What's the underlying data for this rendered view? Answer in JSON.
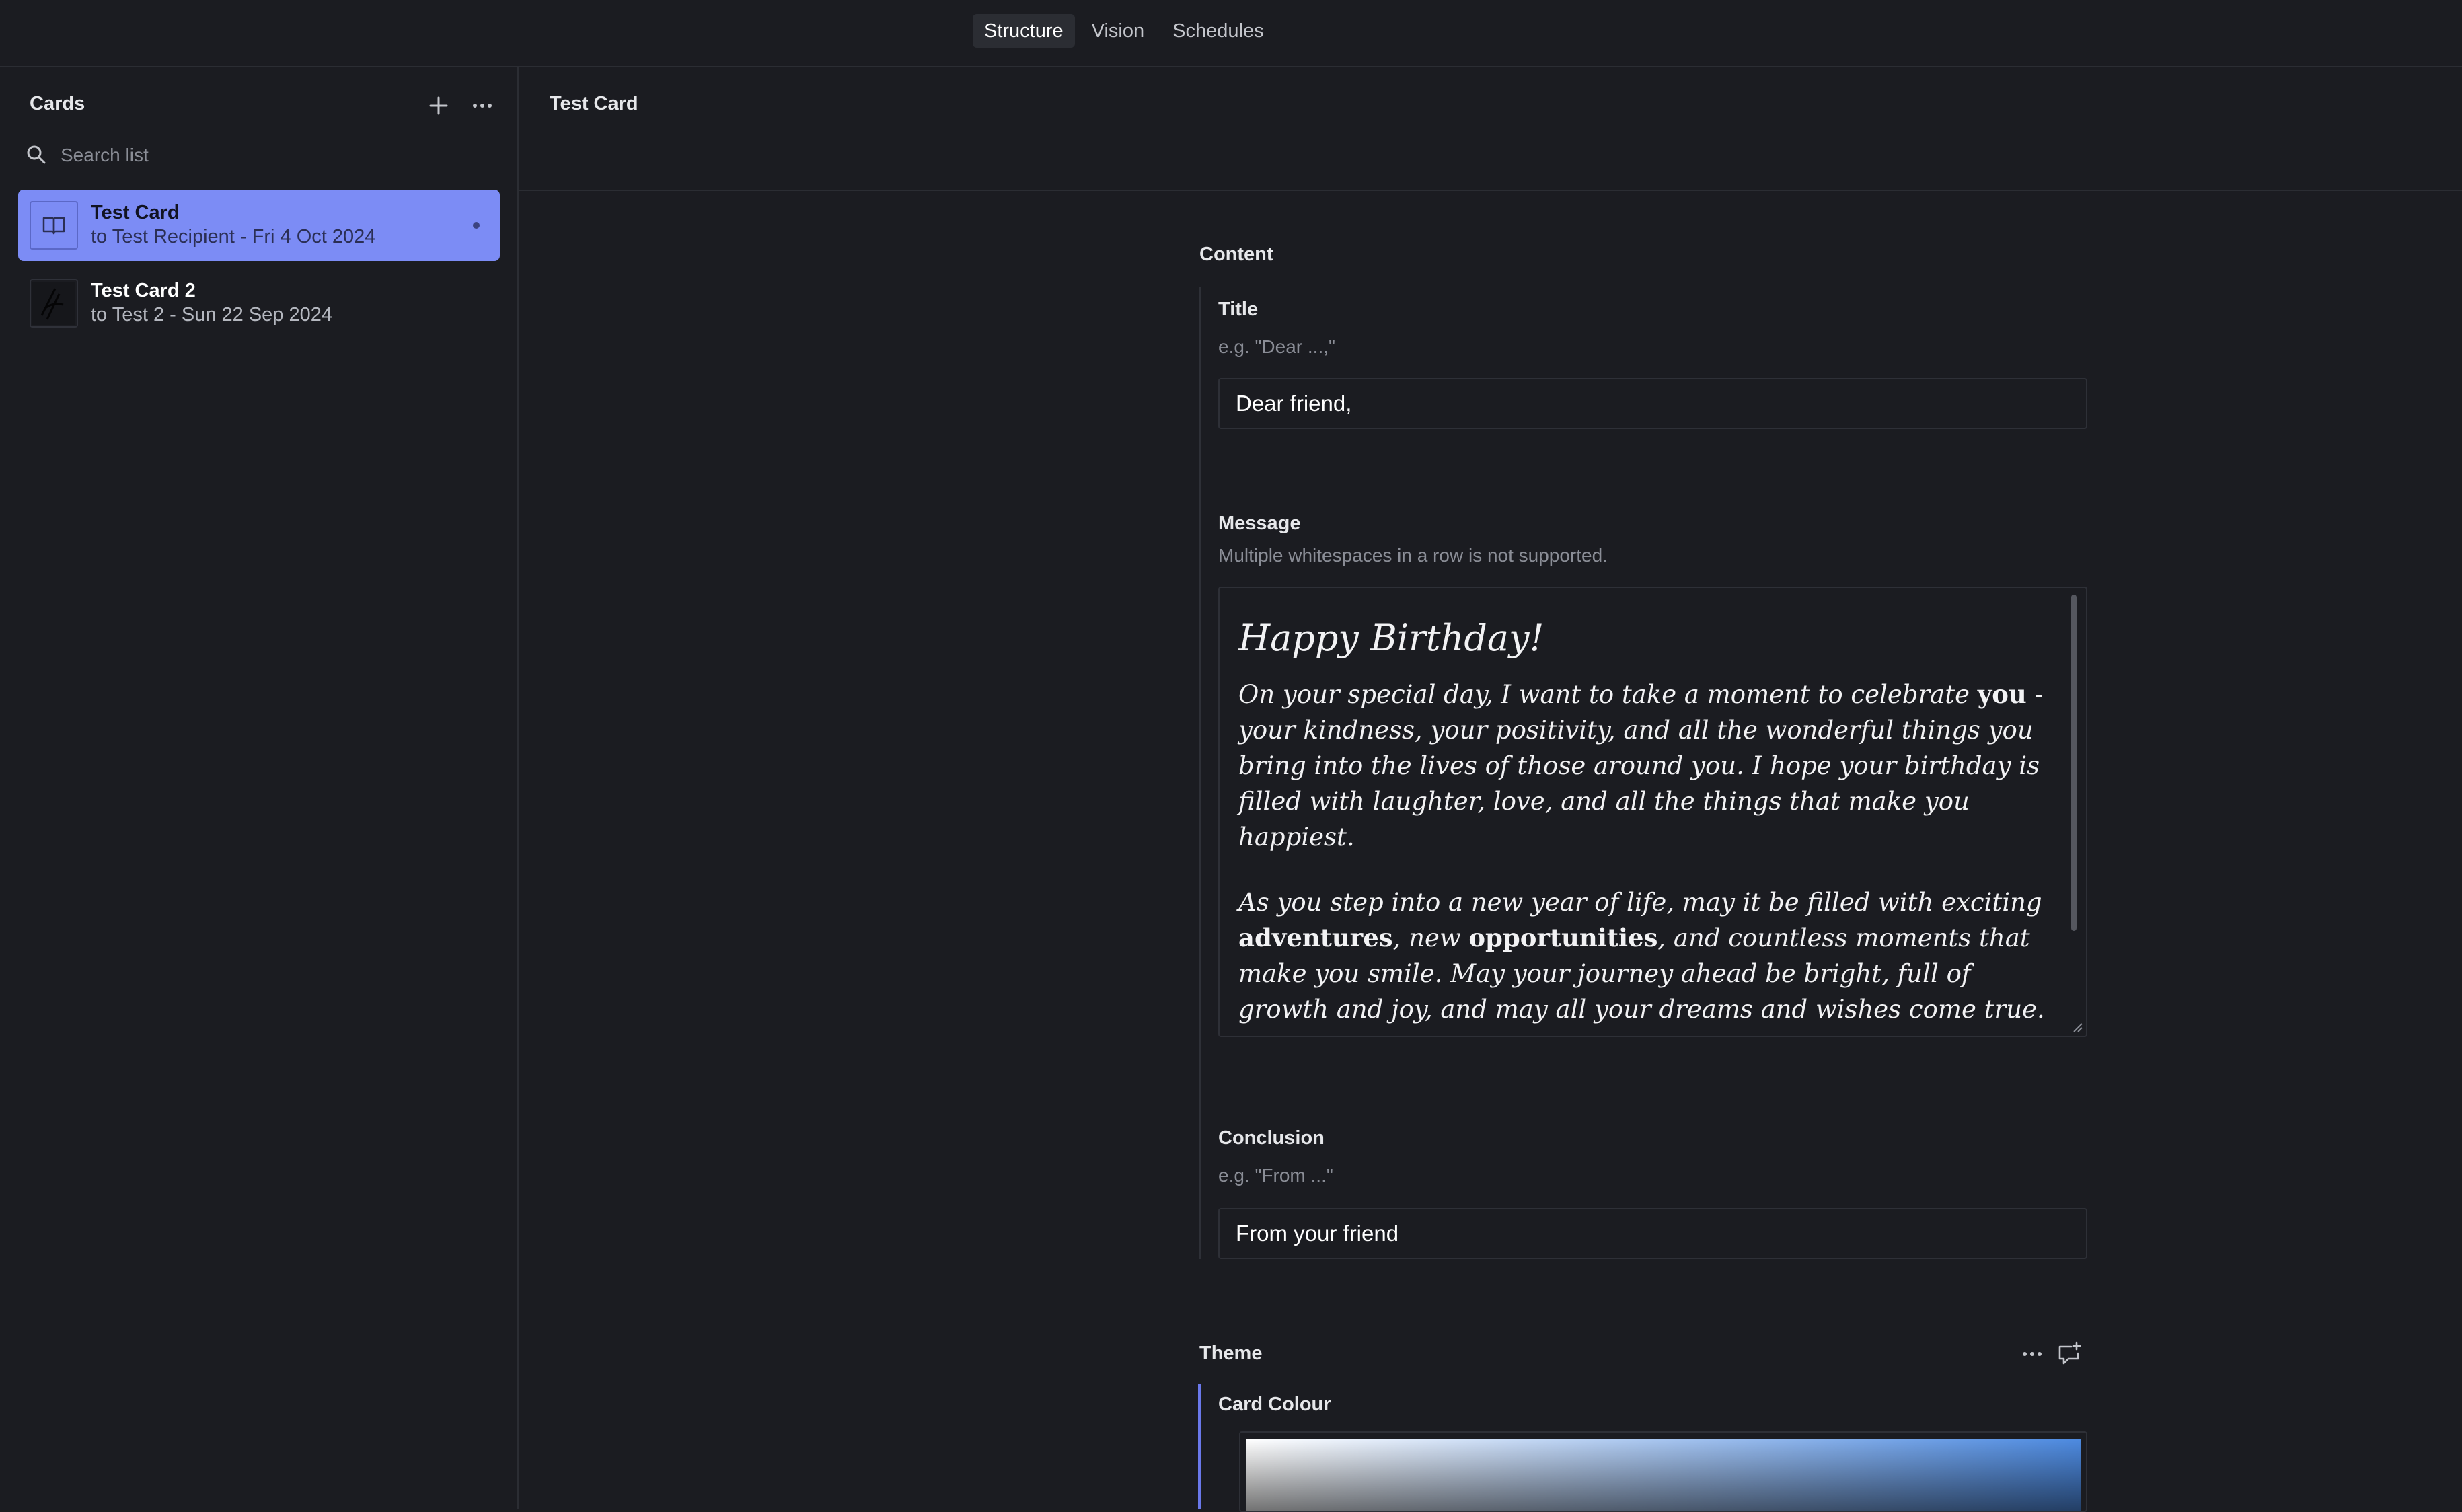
{
  "top_nav": {
    "tabs": [
      {
        "label": "Structure",
        "active": true
      },
      {
        "label": "Vision",
        "active": false
      },
      {
        "label": "Schedules",
        "active": false
      }
    ]
  },
  "sidebar": {
    "title": "Cards",
    "add_icon": "plus-icon",
    "more_icon": "ellipsis-icon",
    "search": {
      "placeholder": "Search list",
      "value": ""
    },
    "items": [
      {
        "title": "Test Card",
        "subtitle": "to Test Recipient - Fri 4 Oct 2024",
        "selected": true,
        "icon": "open-book-icon"
      },
      {
        "title": "Test Card 2",
        "subtitle": "to Test 2 - Sun 22 Sep 2024",
        "selected": false,
        "icon": "card-thumbnail"
      }
    ]
  },
  "main": {
    "header_title": "Test Card",
    "content": {
      "section_label": "Content",
      "title_field": {
        "label": "Title",
        "description": "e.g. \"Dear ...,\"",
        "value": "Dear friend,"
      },
      "message_field": {
        "label": "Message",
        "description": "Multiple whitespaces in a row is not supported.",
        "heading": "Happy Birthday!",
        "p1_a": "On your special day, I want to take a moment to celebrate ",
        "p1_b": "you",
        "p1_c": " - your kindness, your positivity, and all the wonderful things you bring into the lives of those around you. I hope your birthday is filled with laughter, love, and all the things that make you happiest.",
        "p2_a": "As you step into a new year of life, may it be filled with exciting ",
        "p2_b": "adventures",
        "p2_c": ", new ",
        "p2_d": "opportunities",
        "p2_e": ", and countless moments that make you smile. May your journey ahead be bright, full of growth and joy, and may all your dreams and wishes come true."
      },
      "conclusion_field": {
        "label": "Conclusion",
        "description": "e.g. \"From ...\"",
        "value": "From your friend"
      }
    },
    "theme": {
      "section_label": "Theme",
      "more_icon": "ellipsis-icon",
      "comment_icon": "comment-add-icon",
      "card_colour_label": "Card Colour"
    }
  },
  "colors": {
    "background": "#1b1c21",
    "accent": "#7c8cf5",
    "border": "#2e3037"
  }
}
